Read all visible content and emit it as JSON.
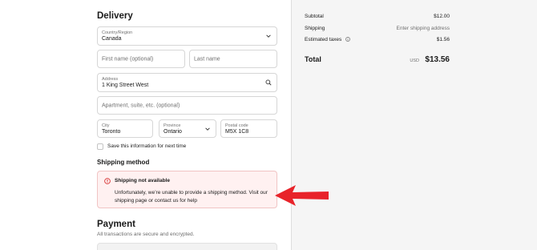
{
  "delivery": {
    "heading": "Delivery",
    "country": {
      "label": "Country/Region",
      "value": "Canada"
    },
    "first_name_placeholder": "First name (optional)",
    "last_name_placeholder": "Last name",
    "address": {
      "label": "Address",
      "value": "1 King Street West"
    },
    "apartment_placeholder": "Apartment, suite, etc. (optional)",
    "city": {
      "label": "City",
      "value": "Toronto"
    },
    "province": {
      "label": "Province",
      "value": "Ontario"
    },
    "postal": {
      "label": "Postal code",
      "value": "M5X 1C8"
    },
    "save_info_label": "Save this information for next time"
  },
  "shipping": {
    "heading": "Shipping method",
    "alert_title": "Shipping not available",
    "alert_body": "Unfortunately, we’re unable to provide a shipping method. Visit our shipping page or contact us for help"
  },
  "payment": {
    "heading": "Payment",
    "subtitle": "All transactions are secure and encrypted."
  },
  "summary": {
    "subtotal_label": "Subtotal",
    "subtotal_value": "$12.00",
    "shipping_label": "Shipping",
    "shipping_value": "Enter shipping address",
    "taxes_label": "Estimated taxes",
    "taxes_value": "$1.56",
    "total_label": "Total",
    "total_currency": "USD",
    "total_value": "$13.56"
  },
  "colors": {
    "alert_bg": "#fff1f1",
    "alert_icon": "#d52b2b",
    "annotation_arrow": "#e8232a",
    "summary_bg": "#f5f5f5"
  },
  "icons": {
    "country": "chevron-down-icon",
    "address": "search-icon",
    "province": "chevron-down-icon",
    "alert": "error-circle-icon",
    "taxes": "info-icon"
  }
}
